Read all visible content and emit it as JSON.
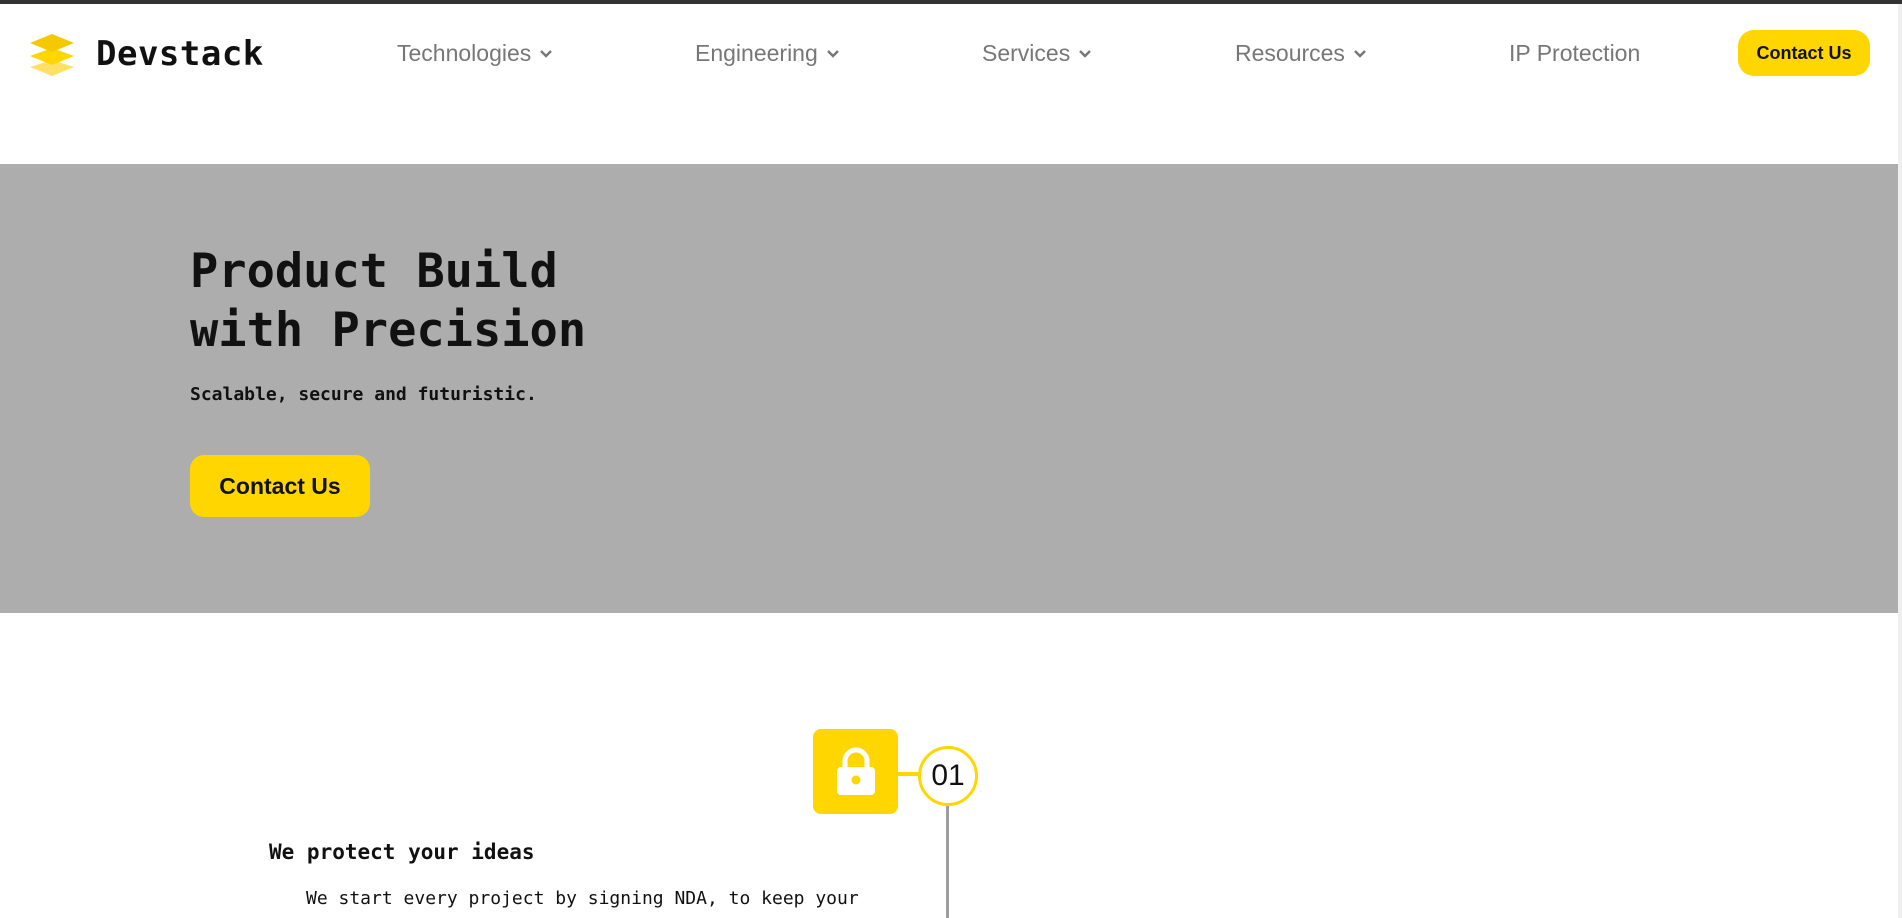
{
  "brand": {
    "name": "Devstack",
    "logo_icon": "layers-icon"
  },
  "nav": {
    "items": [
      {
        "label": "Technologies",
        "has_dropdown": true
      },
      {
        "label": "Engineering",
        "has_dropdown": true
      },
      {
        "label": "Services",
        "has_dropdown": true
      },
      {
        "label": "Resources",
        "has_dropdown": true
      },
      {
        "label": "IP Protection",
        "has_dropdown": false
      }
    ],
    "cta_label": "Contact Us"
  },
  "hero": {
    "title_line1": "Product Build",
    "title_line2": "with Precision",
    "subtitle": "Scalable, secure and futuristic.",
    "cta_label": "Contact Us"
  },
  "features": [
    {
      "number": "01",
      "icon": "lock-icon",
      "title": "We protect your ideas",
      "description": "We start every project by signing NDA, to keep your"
    }
  ],
  "colors": {
    "accent": "#FFD600",
    "hero_bg": "#ADADAD",
    "nav_text": "#777777",
    "timeline_line": "#9E9E9E"
  }
}
